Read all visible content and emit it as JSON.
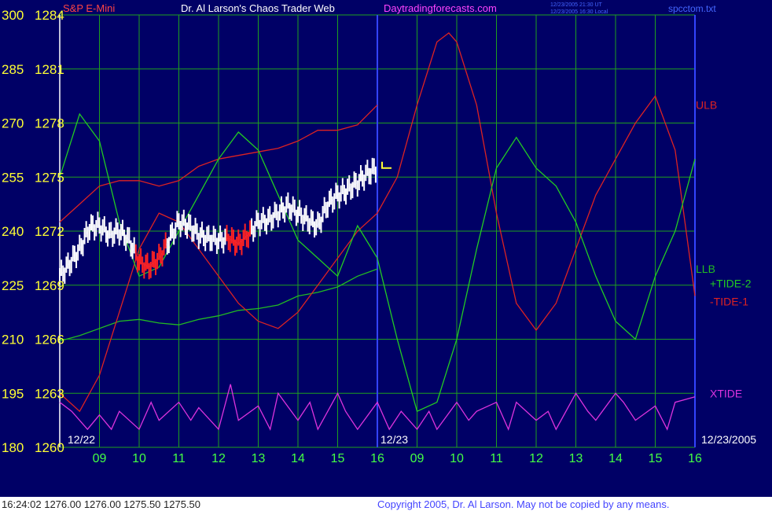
{
  "header": {
    "instrument": "S&P E-Mini",
    "title": "Dr. Al Larson's Chaos Trader Web",
    "site": "Daytradingforecasts.com",
    "time_ut": "12/23/2005 21:30 UT",
    "time_local": "12/23/2005 16:30 Local",
    "file": "spcctom.txt"
  },
  "footer": {
    "quote": "16:24:02  1276.00 1276.00 1275.50 1275.50",
    "copyright": "Copyright 2005, Dr. Al Larson. May not be copied by any means."
  },
  "date_labels": [
    "12/22",
    "12/23",
    "12/23/2005"
  ],
  "colors": {
    "background": "#000066",
    "frame": "#ffffff",
    "grid": "#1f9f1f",
    "axis_text": "#ffff33",
    "hour_text": "#44ff44",
    "ulb": "#dd2222",
    "llb": "#22bb22",
    "tide1": "#dd2222",
    "tide2": "#22cc22",
    "xtide": "#dd33dd",
    "price_bars": "#ffffff",
    "price_bars_red": "#ff2222",
    "trend_line": "#3344ff",
    "title_text": "#ffffff",
    "site_text": "#ff44ff",
    "time_text": "#4466ff",
    "copyright_text": "#4444ff",
    "quote_text": "#222222"
  },
  "chart_data": {
    "type": "line",
    "y_left_ticks": [
      300,
      285,
      270,
      255,
      240,
      225,
      210,
      195,
      180
    ],
    "y_price_ticks": [
      1284,
      1281,
      1278,
      1275,
      1272,
      1269,
      1266,
      1263,
      1260
    ],
    "ylim_left": [
      180,
      300
    ],
    "ylim_price": [
      1260,
      1284
    ],
    "x_ticks": [
      "09",
      "10",
      "11",
      "12",
      "13",
      "14",
      "15",
      "16",
      "09",
      "10",
      "11",
      "12",
      "13",
      "14",
      "15",
      "16"
    ],
    "xlim": [
      8.0,
      24.0
    ],
    "series": [
      {
        "name": "ULB",
        "axis": "price",
        "x": [
          8.0,
          8.5,
          9.0,
          9.5,
          10.0,
          10.5,
          11.0,
          11.5,
          12.0,
          12.5,
          13.0,
          13.5,
          14.0,
          14.5,
          15.0,
          15.5,
          16.0
        ],
        "y": [
          1272.5,
          1273.5,
          1274.5,
          1274.8,
          1274.8,
          1274.5,
          1274.8,
          1275.6,
          1276.0,
          1276.2,
          1276.4,
          1276.6,
          1277.0,
          1277.6,
          1277.6,
          1277.9,
          1279.0
        ]
      },
      {
        "name": "LLB",
        "axis": "price",
        "x": [
          8.0,
          8.5,
          9.0,
          9.5,
          10.0,
          10.5,
          11.0,
          11.5,
          12.0,
          12.5,
          13.0,
          13.5,
          14.0,
          14.5,
          15.0,
          15.5,
          16.0
        ],
        "y": [
          1265.9,
          1266.2,
          1266.6,
          1267.0,
          1267.1,
          1266.9,
          1266.8,
          1267.1,
          1267.3,
          1267.6,
          1267.7,
          1267.9,
          1268.4,
          1268.6,
          1268.9,
          1269.5,
          1269.9
        ]
      },
      {
        "name": "-TIDE-1",
        "axis": "price",
        "x": [
          8.0,
          8.5,
          9.0,
          9.5,
          10.0,
          10.5,
          11.0,
          11.5,
          12.0,
          12.5,
          13.0,
          13.5,
          14.0,
          14.5,
          15.0,
          15.5,
          16.0,
          16.5,
          17.0,
          17.5,
          17.8,
          18.0,
          18.5,
          19.0,
          19.5,
          20.0,
          20.5,
          21.0,
          21.5,
          22.0,
          22.5,
          23.0,
          23.5,
          24.0
        ],
        "y": [
          1263.0,
          1262.0,
          1264.0,
          1267.5,
          1271.0,
          1273.0,
          1272.5,
          1271.0,
          1269.5,
          1268.0,
          1267.0,
          1266.6,
          1267.5,
          1269.0,
          1270.5,
          1272.0,
          1273.0,
          1275.0,
          1279.0,
          1282.5,
          1283.0,
          1282.5,
          1279.0,
          1273.0,
          1268.0,
          1266.5,
          1268.0,
          1271.0,
          1274.0,
          1276.0,
          1278.0,
          1279.5,
          1276.5,
          1268.4
        ]
      },
      {
        "name": "+TIDE-2",
        "axis": "price",
        "x": [
          8.0,
          8.5,
          9.0,
          9.5,
          10.0,
          10.5,
          11.0,
          11.5,
          12.0,
          12.5,
          13.0,
          13.5,
          14.0,
          14.5,
          15.0,
          15.5,
          16.0,
          16.5,
          17.0,
          17.5,
          18.0,
          18.5,
          19.0,
          19.5,
          20.0,
          20.5,
          21.0,
          21.5,
          22.0,
          22.5,
          23.0,
          23.5,
          24.0
        ],
        "y": [
          1275.0,
          1278.5,
          1277.0,
          1272.5,
          1269.5,
          1270.0,
          1272.0,
          1274.0,
          1276.0,
          1277.5,
          1276.5,
          1274.0,
          1271.5,
          1270.5,
          1269.5,
          1272.3,
          1270.5,
          1266.0,
          1262.0,
          1262.5,
          1266.0,
          1271.0,
          1275.5,
          1277.2,
          1275.5,
          1274.5,
          1272.5,
          1269.5,
          1267.0,
          1266.0,
          1269.5,
          1272.0,
          1276.0
        ]
      },
      {
        "name": "XTIDE",
        "axis": "price",
        "x": [
          8.0,
          8.3,
          8.7,
          9.0,
          9.3,
          9.5,
          10.0,
          10.3,
          10.5,
          11.0,
          11.3,
          11.5,
          12.0,
          12.3,
          12.5,
          13.0,
          13.3,
          13.5,
          14.0,
          14.3,
          14.5,
          15.0,
          15.2,
          15.5,
          16.0,
          16.3,
          16.6,
          17.0,
          17.3,
          17.5,
          18.0,
          18.3,
          18.5,
          19.0,
          19.3,
          19.5,
          20.0,
          20.3,
          20.5,
          21.0,
          21.3,
          21.5,
          22.0,
          22.2,
          22.5,
          23.0,
          23.3,
          23.5,
          24.0
        ],
        "y": [
          1262.5,
          1262.0,
          1261.0,
          1261.8,
          1261.0,
          1262.0,
          1261.0,
          1262.5,
          1261.5,
          1262.5,
          1261.5,
          1262.2,
          1261.0,
          1263.5,
          1261.5,
          1262.3,
          1261.0,
          1263.0,
          1261.5,
          1262.5,
          1261.0,
          1263.0,
          1262.0,
          1261.0,
          1262.5,
          1261.0,
          1262.0,
          1261.0,
          1262.0,
          1261.0,
          1262.5,
          1261.5,
          1262.0,
          1262.5,
          1261.0,
          1262.5,
          1261.5,
          1262.0,
          1261.0,
          1263.0,
          1262.0,
          1261.5,
          1263.0,
          1262.5,
          1261.5,
          1262.3,
          1261.0,
          1262.5,
          1262.8
        ]
      },
      {
        "name": "S&P E-Mini",
        "axis": "price",
        "x": [
          8.0,
          8.25,
          8.5,
          8.75,
          9.0,
          9.25,
          9.5,
          9.75,
          10.0,
          10.25,
          10.5,
          10.75,
          11.0,
          11.25,
          11.5,
          11.75,
          12.0,
          12.25,
          12.5,
          12.75,
          13.0,
          13.25,
          13.5,
          13.75,
          14.0,
          14.25,
          14.5,
          14.75,
          15.0,
          15.25,
          15.5,
          15.75,
          16.0
        ],
        "y": [
          1269.5,
          1270.2,
          1271.0,
          1272.2,
          1272.3,
          1271.8,
          1272.0,
          1271.5,
          1270.3,
          1270.0,
          1270.5,
          1271.5,
          1272.5,
          1272.3,
          1271.8,
          1271.6,
          1271.5,
          1271.6,
          1271.3,
          1271.8,
          1272.5,
          1272.6,
          1273.0,
          1273.4,
          1273.0,
          1272.6,
          1272.3,
          1273.5,
          1274.0,
          1274.3,
          1274.7,
          1275.2,
          1275.5
        ]
      }
    ]
  }
}
